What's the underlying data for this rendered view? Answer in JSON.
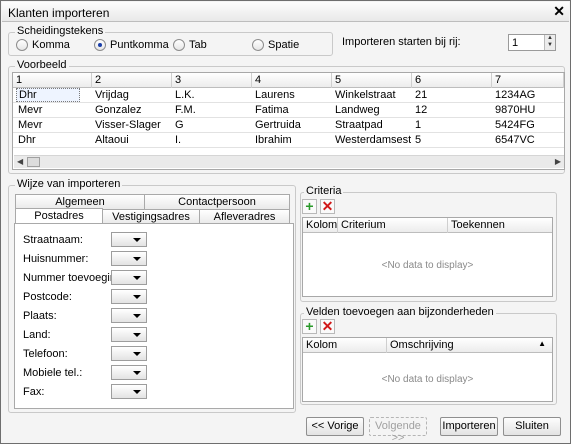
{
  "window": {
    "title": "Klanten importeren",
    "close_icon": "close-icon"
  },
  "separators": {
    "legend": "Scheidingstekens",
    "options": [
      {
        "label": "Komma",
        "selected": false
      },
      {
        "label": "Puntkomma",
        "selected": true
      },
      {
        "label": "Tab",
        "selected": false
      },
      {
        "label": "Spatie",
        "selected": false
      }
    ]
  },
  "start_row": {
    "label": "Importeren starten bij rij:",
    "value": "1"
  },
  "preview": {
    "legend": "Voorbeeld",
    "columns": [
      "1",
      "2",
      "3",
      "4",
      "5",
      "6",
      "7"
    ],
    "rows": [
      [
        "Dhr",
        "Vrijdag",
        "L.K.",
        "Laurens",
        "Winkelstraat",
        "21",
        "1234AG"
      ],
      [
        "Mevr",
        "Gonzalez",
        "F.M.",
        "Fatima",
        "Landweg",
        "12",
        "9870HU"
      ],
      [
        "Mevr",
        "Visser-Slager",
        "G",
        "Gertruida",
        "Straatpad",
        "1",
        "5424FG"
      ],
      [
        "Dhr",
        "Altaoui",
        "I.",
        "Ibrahim",
        "Westerdamsestraat",
        "5",
        "6547VC"
      ]
    ]
  },
  "import_mode": {
    "legend": "Wijze van importeren",
    "tabs_row1": [
      "Algemeen",
      "Contactpersoon"
    ],
    "tabs_row2": [
      "Postadres",
      "Vestigingsadres",
      "Afleveradres"
    ],
    "active_tab": "Postadres",
    "fields": [
      "Straatnaam:",
      "Huisnummer:",
      "Nummer toevoeging:",
      "Postcode:",
      "Plaats:",
      "Land:",
      "Telefoon:",
      "Mobiele tel.:",
      "Fax:"
    ]
  },
  "criteria": {
    "legend": "Criteria",
    "columns": [
      "Kolom",
      "Criterium",
      "Toekennen"
    ],
    "empty_text": "<No data to display>"
  },
  "extra_fields": {
    "legend": "Velden toevoegen aan bijzonderheden",
    "columns": [
      "Kolom",
      "Omschrijving"
    ],
    "empty_text": "<No data to display>"
  },
  "buttons": {
    "prev": "<< Vorige",
    "next": "Volgende >>",
    "import": "Importeren",
    "close": "Sluiten"
  }
}
